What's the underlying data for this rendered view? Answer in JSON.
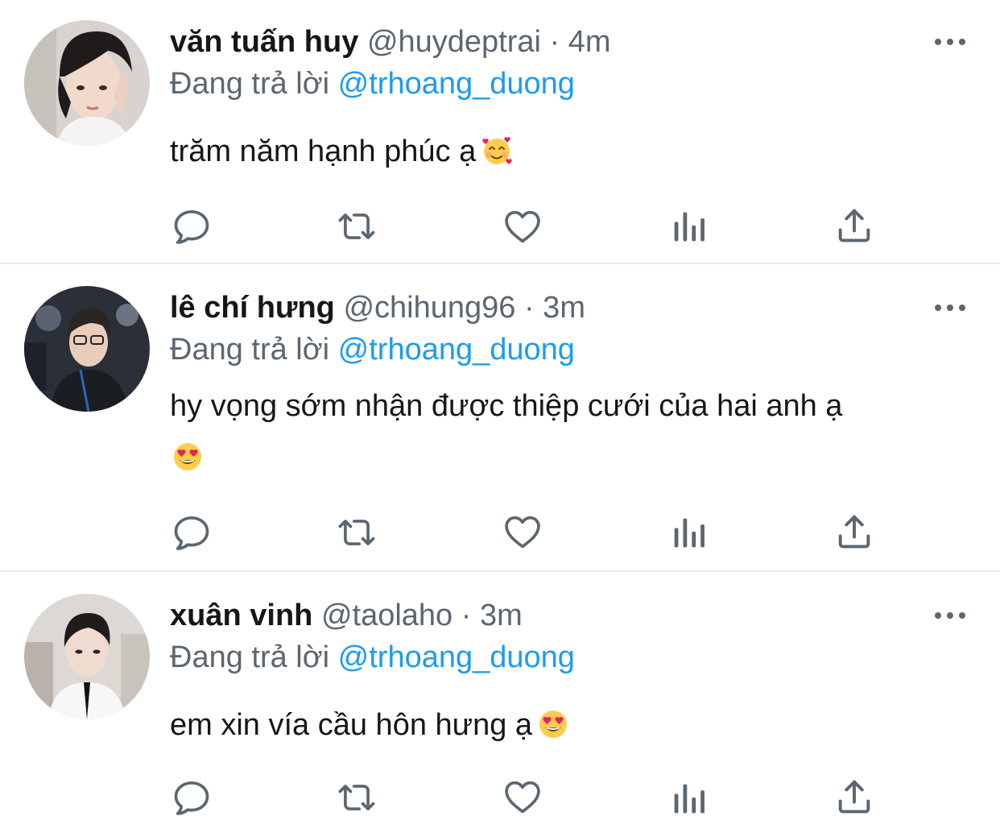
{
  "tweets": [
    {
      "display_name": "văn tuấn huy",
      "handle": "@huydeptrai",
      "time": "· 4m",
      "reply_prefix": "Đang trả lời",
      "reply_to": "@trhoang_duong",
      "text": "trăm năm hạnh phúc ạ",
      "emoji": "smiling-face-with-hearts-icon"
    },
    {
      "display_name": "lê chí hưng",
      "handle": "@chihung96",
      "time": "· 3m",
      "reply_prefix": "Đang trả lời",
      "reply_to": "@trhoang_duong",
      "text": "hy vọng sớm nhận được thiệp cưới của hai anh ạ",
      "emoji": "heart-eyes-icon"
    },
    {
      "display_name": "xuân vinh",
      "handle": "@taolaho",
      "time": "· 3m",
      "reply_prefix": "Đang trả lời",
      "reply_to": "@trhoang_duong",
      "text": "em xin vía cầu hôn hưng ạ",
      "emoji": "heart-eyes-icon"
    }
  ],
  "actions": [
    "reply-icon",
    "retweet-icon",
    "like-icon",
    "analytics-icon",
    "share-icon"
  ],
  "colors": {
    "text": "#14171a",
    "secondary": "#5b6670",
    "link": "#1d9bf0",
    "divider": "#e7e7e9"
  }
}
